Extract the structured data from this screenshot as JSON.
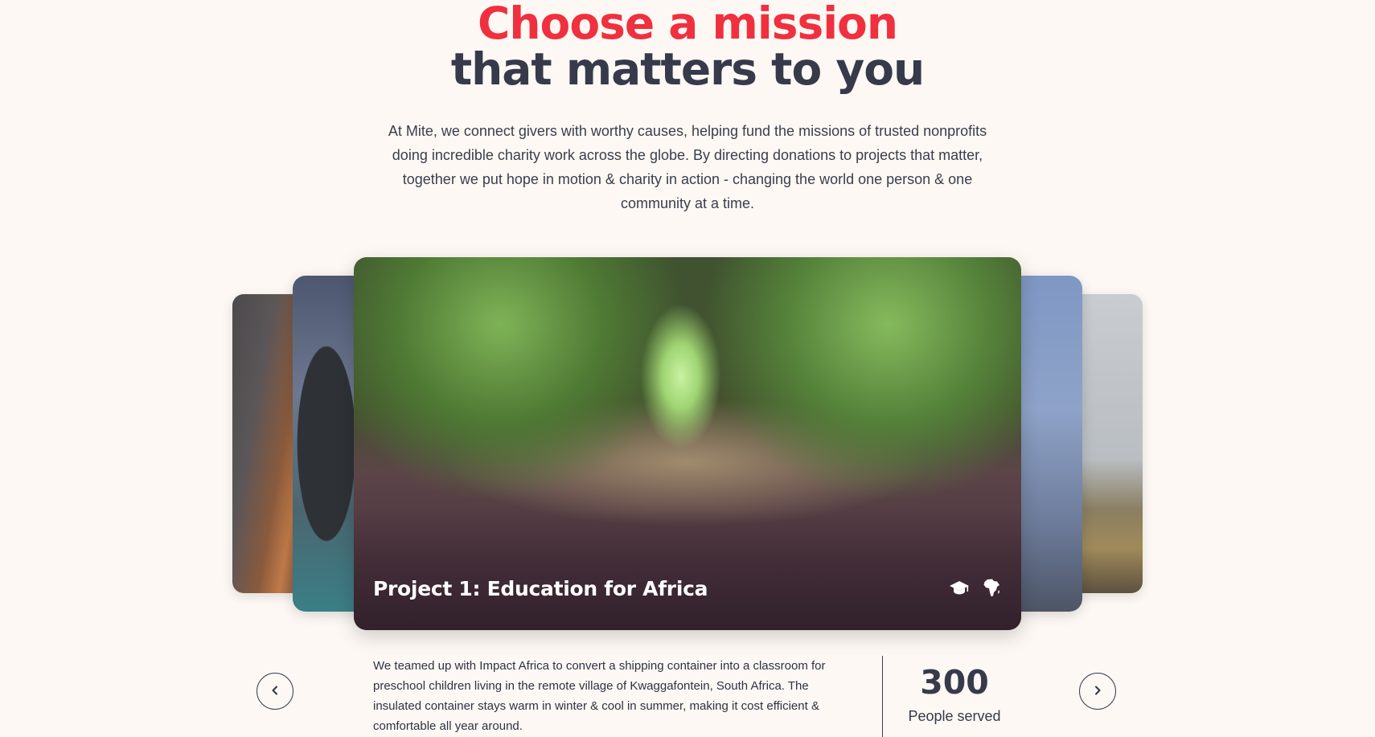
{
  "header": {
    "title_accent": "Choose a mission",
    "title_main": "that matters to you",
    "intro": "At Mite, we connect givers with worthy causes, helping fund the missions of trusted nonprofits doing incredible charity work across the globe. By directing donations to projects that matter, together we put hope in motion & charity in action - changing the world one person & one community at a time."
  },
  "carousel": {
    "active_project": {
      "title": "Project 1: Education for Africa",
      "icons": [
        "graduation-cap-icon",
        "africa-map-icon"
      ],
      "description": "We teamed up with Impact Africa to convert a shipping container into a classroom for preschool children living in the remote village of Kwaggafontein, South Africa. The insulated container stays warm in winter & cool in summer, making it cost efficient & comfortable all year around.",
      "stat": {
        "value": "300",
        "label": "People served"
      }
    },
    "prev_icon": "chevron-left-icon",
    "next_icon": "chevron-right-icon"
  },
  "colors": {
    "accent": "#f0303e",
    "heading": "#363a4a",
    "background": "#fdf8f4"
  }
}
